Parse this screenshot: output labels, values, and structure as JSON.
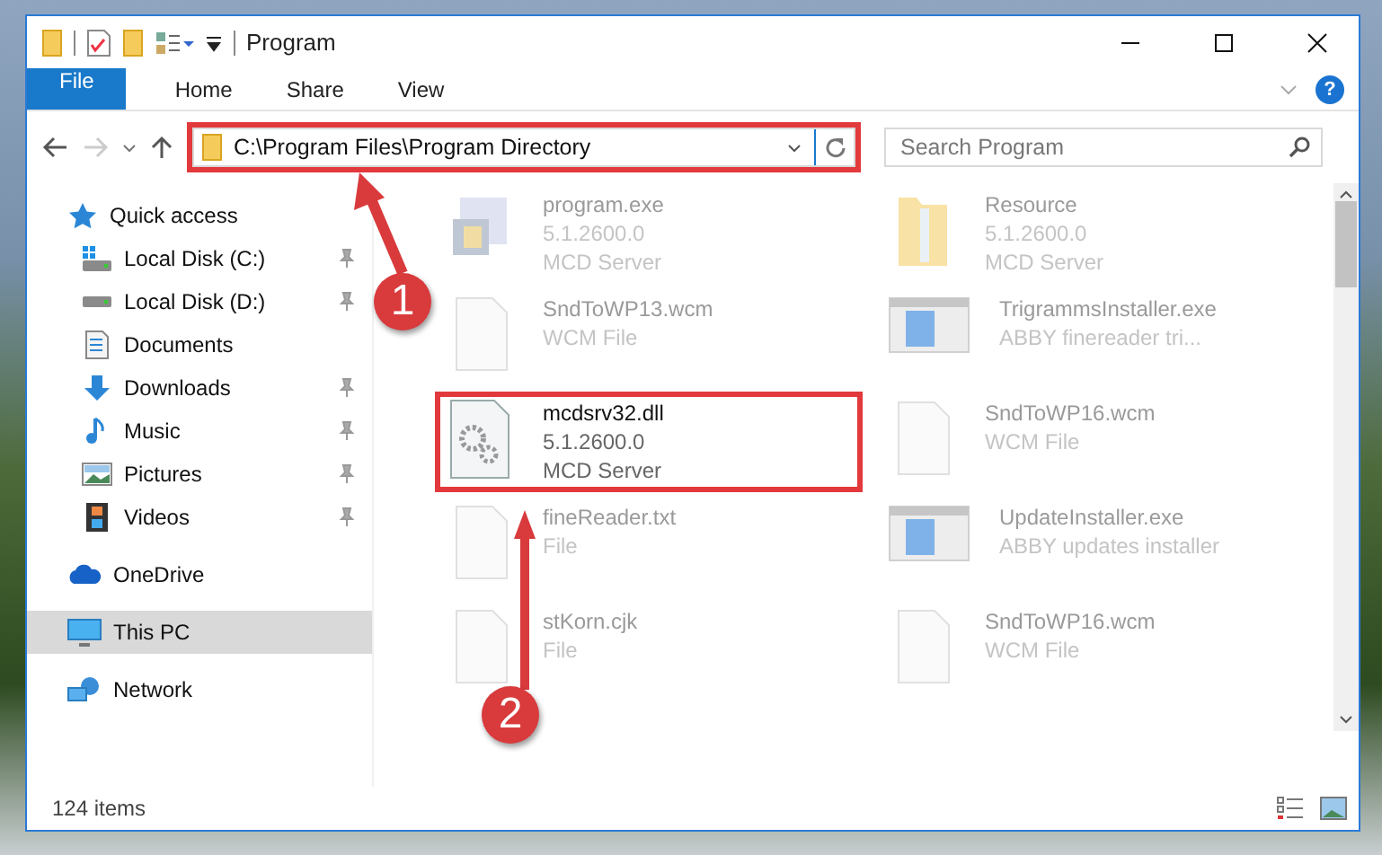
{
  "window": {
    "title": "Program"
  },
  "ribbon_tabs": [
    {
      "label": "File",
      "kind": "file"
    },
    {
      "label": "Home",
      "kind": "tab"
    },
    {
      "label": "Share",
      "kind": "tab"
    },
    {
      "label": "View",
      "kind": "tab"
    }
  ],
  "help_button": {
    "label": "?"
  },
  "address_bar": {
    "path": "C:\\Program Files\\Program Directory",
    "highlighted": true
  },
  "search": {
    "placeholder": "Search Program"
  },
  "sidebar": {
    "items": [
      {
        "label": "Quick access",
        "kind": "star",
        "selected": false,
        "children": [
          {
            "label": "Local Disk (C:)",
            "kind": "drive-c",
            "pinned": true
          },
          {
            "label": "Local Disk (D:)",
            "kind": "drive",
            "pinned": true
          },
          {
            "label": "Documents",
            "kind": "document",
            "pinned": false
          },
          {
            "label": "Downloads",
            "kind": "download",
            "pinned": true
          },
          {
            "label": "Music",
            "kind": "music",
            "pinned": true
          },
          {
            "label": "Pictures",
            "kind": "pictures",
            "pinned": true
          },
          {
            "label": "Videos",
            "kind": "videos",
            "pinned": true
          }
        ]
      },
      {
        "label": "OneDrive",
        "kind": "cloud",
        "selected": false
      },
      {
        "label": "This PC",
        "kind": "pc",
        "selected": true
      },
      {
        "label": "Network",
        "kind": "network",
        "selected": false
      }
    ]
  },
  "files": [
    {
      "kind": "app",
      "lines": [
        "program.exe",
        "5.1.2600.0",
        "MCD Server"
      ],
      "dimmed": true,
      "highlighted": false
    },
    {
      "kind": "folder",
      "lines": [
        "Resource",
        "5.1.2600.0",
        "MCD Server"
      ],
      "dimmed": true,
      "highlighted": false
    },
    {
      "kind": "blank",
      "lines": [
        "SndToWP13.wcm",
        "WCM File"
      ],
      "dimmed": true,
      "highlighted": false
    },
    {
      "kind": "installer",
      "lines": [
        "TrigrammsInstaller.exe",
        "ABBY finereader tri..."
      ],
      "dimmed": true,
      "highlighted": false
    },
    {
      "kind": "gears",
      "lines": [
        "mcdsrv32.dll",
        "5.1.2600.0",
        "MCD Server"
      ],
      "dimmed": false,
      "highlighted": true
    },
    {
      "kind": "blank",
      "lines": [
        "SndToWP16.wcm",
        "WCM File"
      ],
      "dimmed": true,
      "highlighted": false
    },
    {
      "kind": "blank",
      "lines": [
        "fineReader.txt",
        "File"
      ],
      "dimmed": true,
      "highlighted": false
    },
    {
      "kind": "installer",
      "lines": [
        "UpdateInstaller.exe",
        "ABBY updates installer"
      ],
      "dimmed": true,
      "highlighted": false
    },
    {
      "kind": "blank",
      "lines": [
        "stKorn.cjk",
        "File"
      ],
      "dimmed": true,
      "highlighted": false
    },
    {
      "kind": "blank",
      "lines": [
        "SndToWP16.wcm",
        "WCM File"
      ],
      "dimmed": true,
      "highlighted": false
    }
  ],
  "annotations": [
    {
      "label": "1"
    },
    {
      "label": "2"
    }
  ],
  "status_bar": {
    "item_count": "124 items"
  }
}
